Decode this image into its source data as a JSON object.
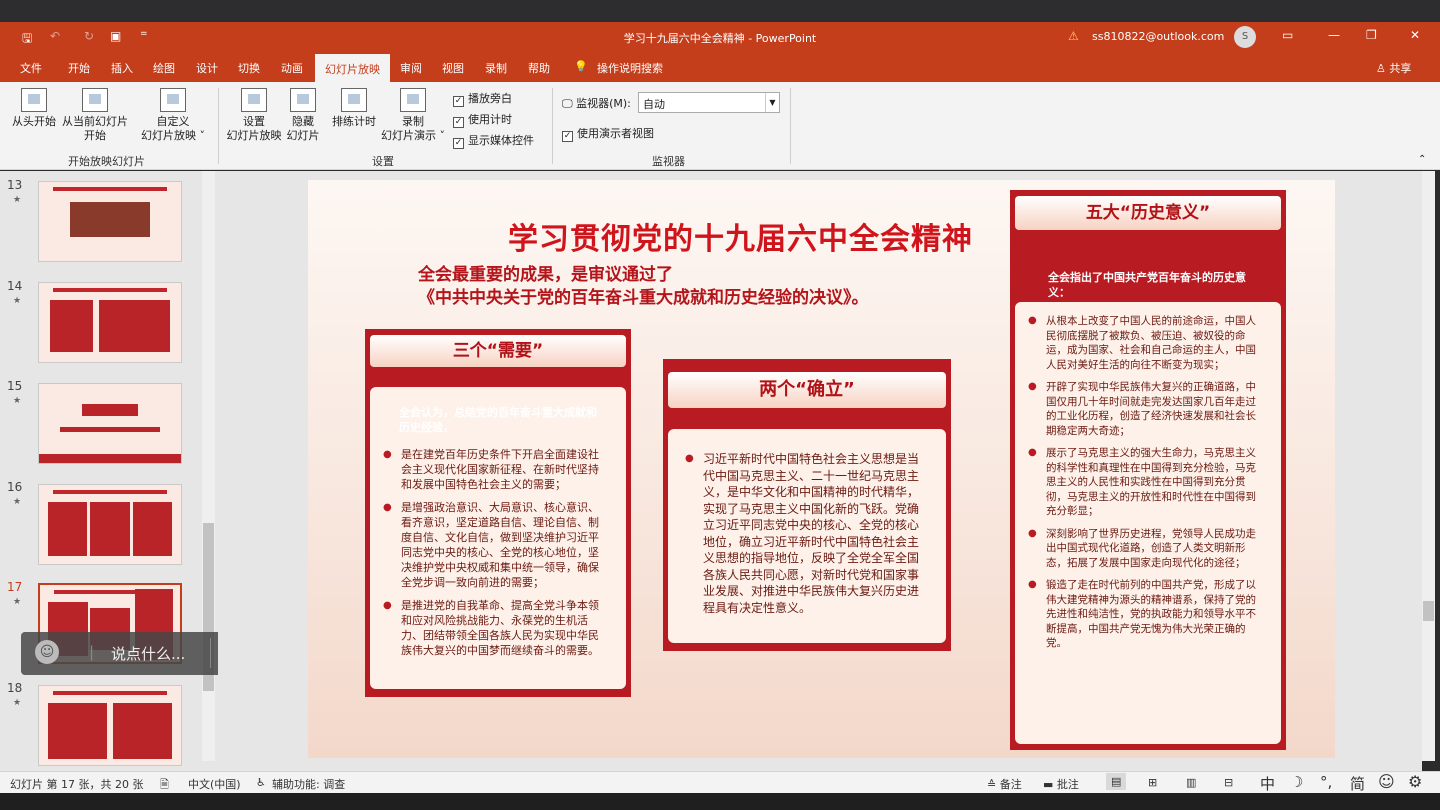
{
  "window": {
    "title": "学习十九届六中全会精神 - PowerPoint",
    "account": "ss810822@outlook.com",
    "avatar": "S",
    "warn_icon": "warning-icon"
  },
  "tabs": [
    {
      "label": "文件"
    },
    {
      "label": "开始"
    },
    {
      "label": "插入"
    },
    {
      "label": "绘图"
    },
    {
      "label": "设计"
    },
    {
      "label": "切换"
    },
    {
      "label": "动画"
    },
    {
      "label": "幻灯片放映"
    },
    {
      "label": "审阅"
    },
    {
      "label": "视图"
    },
    {
      "label": "录制"
    },
    {
      "label": "帮助"
    },
    {
      "label": "操作说明搜索"
    }
  ],
  "share": "共享",
  "ribbon": {
    "from_start": "从头开始",
    "from_current_1": "从当前幻灯片",
    "from_current_2": "开始",
    "custom_1": "自定义",
    "custom_2": "幻灯片放映 ˅",
    "group_start": "开始放映幻灯片",
    "setup_1": "设置",
    "setup_2": "幻灯片放映",
    "hide_1": "隐藏",
    "hide_2": "幻灯片",
    "rehearse": "排练计时",
    "record_1": "录制",
    "record_2": "幻灯片演示 ˅",
    "chk_narration": "播放旁白",
    "chk_timing": "使用计时",
    "chk_media": "显示媒体控件",
    "group_setup": "设置",
    "monitor_label": "监视器(M):",
    "monitor_value": "自动",
    "chk_presenter": "使用演示者视图",
    "group_monitor": "监视器"
  },
  "thumbs": [
    {
      "num": "13",
      "star": "★"
    },
    {
      "num": "14",
      "star": "★"
    },
    {
      "num": "15",
      "star": "★"
    },
    {
      "num": "16",
      "star": "★"
    },
    {
      "num": "17",
      "star": "★"
    },
    {
      "num": "18",
      "star": "★"
    }
  ],
  "chat": {
    "placeholder": "说点什么..."
  },
  "slide": {
    "title": "学习贯彻党的十九届六中全会精神",
    "subtitle_1": "全会最重要的成果，是审议通过了",
    "subtitle_2": "《中共中央关于党的百年奋斗重大成就和历史经验的决议》。",
    "card1": {
      "header": "三个“需要”",
      "lead": "全会认为，总结党的百年奋斗重大成就和历史经验，",
      "items": [
        "是在建党百年历史条件下开启全面建设社会主义现代化国家新征程、在新时代坚持和发展中国特色社会主义的需要；",
        "是增强政治意识、大局意识、核心意识、看齐意识，坚定道路自信、理论自信、制度自信、文化自信，做到坚决维护习近平同志党中央的核心、全党的核心地位，坚决维护党中央权威和集中统一领导，确保全党步调一致向前进的需要；",
        "是推进党的自我革命、提高全党斗争本领和应对风险挑战能力、永葆党的生机活力、团结带领全国各族人民为实现中华民族伟大复兴的中国梦而继续奋斗的需要。"
      ]
    },
    "card2": {
      "header": "两个“确立”",
      "items": [
        "习近平新时代中国特色社会主义思想是当代中国马克思主义、二十一世纪马克思主义，是中华文化和中国精神的时代精华，实现了马克思主义中国化新的飞跃。党确立习近平同志党中央的核心、全党的核心地位，确立习近平新时代中国特色社会主义思想的指导地位，反映了全党全军全国各族人民共同心愿，对新时代党和国家事业发展、对推进中华民族伟大复兴历史进程具有决定性意义。"
      ]
    },
    "card3": {
      "header": "五大“历史意义”",
      "lead": "全会指出了中国共产党百年奋斗的历史意义：",
      "items": [
        "从根本上改变了中国人民的前途命运，中国人民彻底摆脱了被欺负、被压迫、被奴役的命运，成为国家、社会和自己命运的主人，中国人民对美好生活的向往不断变为现实；",
        "开辟了实现中华民族伟大复兴的正确道路，中国仅用几十年时间就走完发达国家几百年走过的工业化历程，创造了经济快速发展和社会长期稳定两大奇迹；",
        "展示了马克思主义的强大生命力，马克思主义的科学性和真理性在中国得到充分检验，马克思主义的人民性和实践性在中国得到充分贯彻，马克思主义的开放性和时代性在中国得到充分彰显；",
        "深刻影响了世界历史进程，党领导人民成功走出中国式现代化道路，创造了人类文明新形态，拓展了发展中国家走向现代化的途径；",
        "锻造了走在时代前列的中国共产党，形成了以伟大建党精神为源头的精神谱系，保持了党的先进性和纯洁性，党的执政能力和领导水平不断提高，中国共产党无愧为伟大光荣正确的党。"
      ]
    }
  },
  "status": {
    "slide_info": "幻灯片 第 17 张，共 20 张",
    "lang": "中文(中国)",
    "access": "辅助功能: 调查",
    "notes": "备注",
    "comments": "批注",
    "ime": "中",
    "ime2": "简"
  }
}
